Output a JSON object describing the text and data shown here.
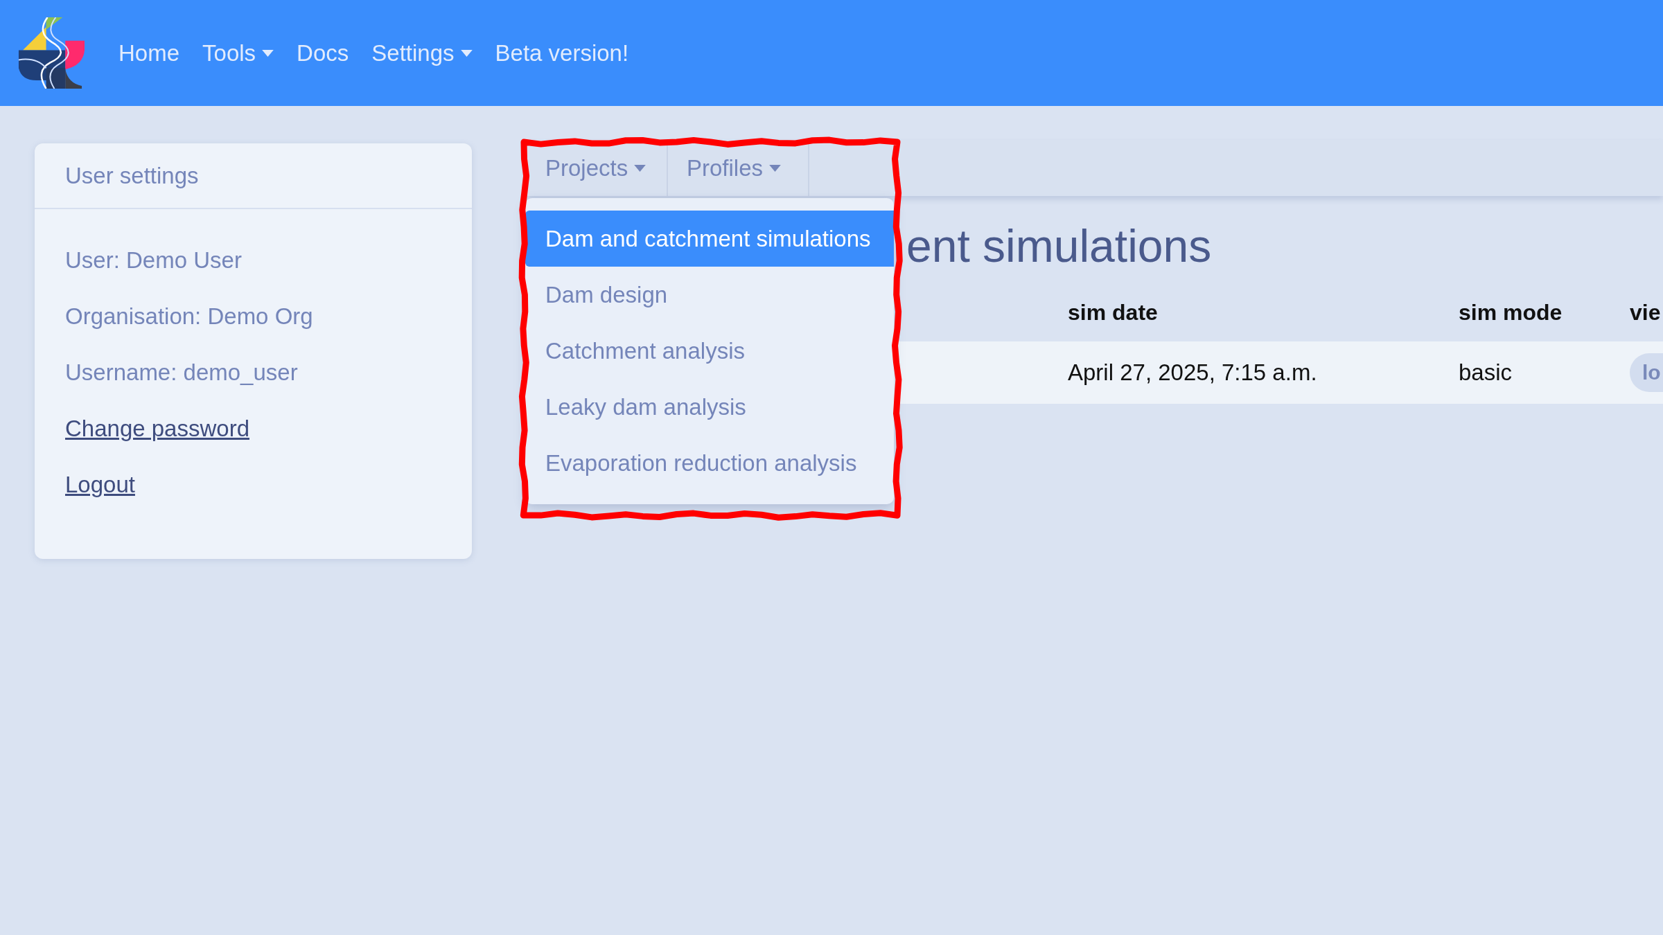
{
  "navbar": {
    "items": [
      {
        "label": "Home",
        "kind": "link"
      },
      {
        "label": "Tools",
        "kind": "dropdown"
      },
      {
        "label": "Docs",
        "kind": "link"
      },
      {
        "label": "Settings",
        "kind": "dropdown"
      },
      {
        "label": "Beta version!",
        "kind": "link"
      }
    ]
  },
  "sidebar": {
    "title": "User settings",
    "items": [
      {
        "text": "User: Demo User",
        "kind": "info"
      },
      {
        "text": "Organisation: Demo Org",
        "kind": "info"
      },
      {
        "text": "Username: demo_user",
        "kind": "info"
      },
      {
        "text": "Change password",
        "kind": "link"
      },
      {
        "text": "Logout",
        "kind": "link"
      }
    ]
  },
  "tabs": [
    {
      "label": "Projects",
      "menu": [
        {
          "label": "Dam and catchment simulations",
          "selected": true
        },
        {
          "label": "Dam design",
          "selected": false
        },
        {
          "label": "Catchment analysis",
          "selected": false
        },
        {
          "label": "Leaky dam analysis",
          "selected": false
        },
        {
          "label": "Evaporation reduction analysis",
          "selected": false
        }
      ]
    },
    {
      "label": "Profiles"
    }
  ],
  "heading": "ent simulations",
  "table": {
    "columns": [
      "sim date",
      "sim mode",
      "vie"
    ],
    "rows": [
      {
        "cells": [
          "April 27, 2025, 7:15 a.m.",
          "basic"
        ],
        "button": "lo"
      }
    ]
  },
  "annotation": {
    "kind": "outline"
  }
}
